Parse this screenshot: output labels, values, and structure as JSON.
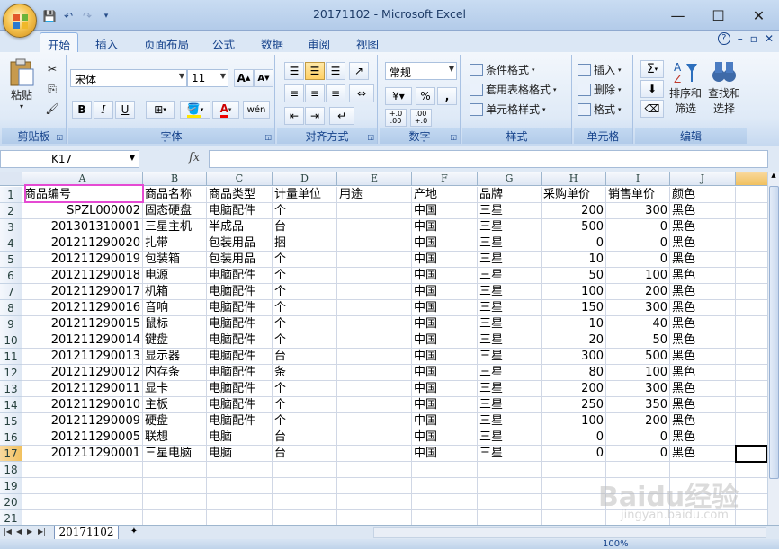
{
  "window": {
    "title": "20171102 - Microsoft Excel",
    "controls": {
      "minimize": "—",
      "maximize": "☐",
      "close": "✕"
    }
  },
  "qat": {
    "save_icon": "save-icon",
    "undo_icon": "undo-icon",
    "redo_icon": "redo-icon"
  },
  "ribbon_tabs": [
    "开始",
    "插入",
    "页面布局",
    "公式",
    "数据",
    "审阅",
    "视图"
  ],
  "ribbon_help": "?",
  "clipboard": {
    "paste": "粘贴",
    "label": "剪贴板"
  },
  "font": {
    "name": "宋体",
    "size": "11",
    "bold": "B",
    "italic": "I",
    "underline": "U",
    "grow": "A",
    "shrink": "A",
    "label": "字体",
    "phonetic": "wén"
  },
  "alignment": {
    "label": "对齐方式"
  },
  "number": {
    "format": "常规",
    "percent": "%",
    "comma": ",",
    "inc": "+.0\n.00",
    "dec": ".00\n+.0",
    "label": "数字"
  },
  "styles": {
    "conditional": "条件格式",
    "table": "套用表格格式",
    "cell": "单元格样式",
    "label": "样式"
  },
  "cells": {
    "insert": "插入",
    "delete": "删除",
    "format": "格式",
    "label": "单元格"
  },
  "editing": {
    "sum": "Σ",
    "sort": "排序和",
    "sort2": "筛选",
    "find": "查找和",
    "find2": "选择",
    "label": "编辑"
  },
  "formula_bar": {
    "name_box": "K17",
    "fx": "fx",
    "formula": ""
  },
  "columns": [
    "A",
    "B",
    "C",
    "D",
    "E",
    "F",
    "G",
    "H",
    "I",
    "J"
  ],
  "rows": [
    [
      "商品编号",
      "商品名称",
      "商品类型",
      "计量单位",
      "用途",
      "产地",
      "品牌",
      "采购单价",
      "销售单价",
      "颜色"
    ],
    [
      "SPZL000002",
      "固态硬盘",
      "电脑配件",
      "个",
      "",
      "中国",
      "三星",
      "200",
      "300",
      "黑色"
    ],
    [
      "201301310001",
      "三星主机",
      "半成品",
      "台",
      "",
      "中国",
      "三星",
      "500",
      "0",
      "黑色"
    ],
    [
      "201211290020",
      "扎带",
      "包装用品",
      "捆",
      "",
      "中国",
      "三星",
      "0",
      "0",
      "黑色"
    ],
    [
      "201211290019",
      "包装箱",
      "包装用品",
      "个",
      "",
      "中国",
      "三星",
      "10",
      "0",
      "黑色"
    ],
    [
      "201211290018",
      "电源",
      "电脑配件",
      "个",
      "",
      "中国",
      "三星",
      "50",
      "100",
      "黑色"
    ],
    [
      "201211290017",
      "机箱",
      "电脑配件",
      "个",
      "",
      "中国",
      "三星",
      "100",
      "200",
      "黑色"
    ],
    [
      "201211290016",
      "音响",
      "电脑配件",
      "个",
      "",
      "中国",
      "三星",
      "150",
      "300",
      "黑色"
    ],
    [
      "201211290015",
      "鼠标",
      "电脑配件",
      "个",
      "",
      "中国",
      "三星",
      "10",
      "40",
      "黑色"
    ],
    [
      "201211290014",
      "键盘",
      "电脑配件",
      "个",
      "",
      "中国",
      "三星",
      "20",
      "50",
      "黑色"
    ],
    [
      "201211290013",
      "显示器",
      "电脑配件",
      "台",
      "",
      "中国",
      "三星",
      "300",
      "500",
      "黑色"
    ],
    [
      "201211290012",
      "内存条",
      "电脑配件",
      "条",
      "",
      "中国",
      "三星",
      "80",
      "100",
      "黑色"
    ],
    [
      "201211290011",
      "显卡",
      "电脑配件",
      "个",
      "",
      "中国",
      "三星",
      "200",
      "300",
      "黑色"
    ],
    [
      "201211290010",
      "主板",
      "电脑配件",
      "个",
      "",
      "中国",
      "三星",
      "250",
      "350",
      "黑色"
    ],
    [
      "201211290009",
      "硬盘",
      "电脑配件",
      "个",
      "",
      "中国",
      "三星",
      "100",
      "200",
      "黑色"
    ],
    [
      "201211290005",
      "联想",
      "电脑",
      "台",
      "",
      "中国",
      "三星",
      "0",
      "0",
      "黑色"
    ],
    [
      "201211290001",
      "三星电脑",
      "电脑",
      "台",
      "",
      "中国",
      "三星",
      "0",
      "0",
      "黑色"
    ],
    [
      "",
      "",
      "",
      "",
      "",
      "",
      "",
      "",
      "",
      ""
    ],
    [
      "",
      "",
      "",
      "",
      "",
      "",
      "",
      "",
      "",
      ""
    ],
    [
      "",
      "",
      "",
      "",
      "",
      "",
      "",
      "",
      "",
      ""
    ],
    [
      "",
      "",
      "",
      "",
      "",
      "",
      "",
      "",
      "",
      ""
    ]
  ],
  "sheet_tabs": [
    "20171102"
  ],
  "status": {
    "zoom": "100%"
  },
  "watermark": {
    "text": "Baidu经验",
    "sub": "jingyan.baidu.com"
  },
  "colors": {
    "accent": "#15428b",
    "highlight": "#e54ad3"
  }
}
